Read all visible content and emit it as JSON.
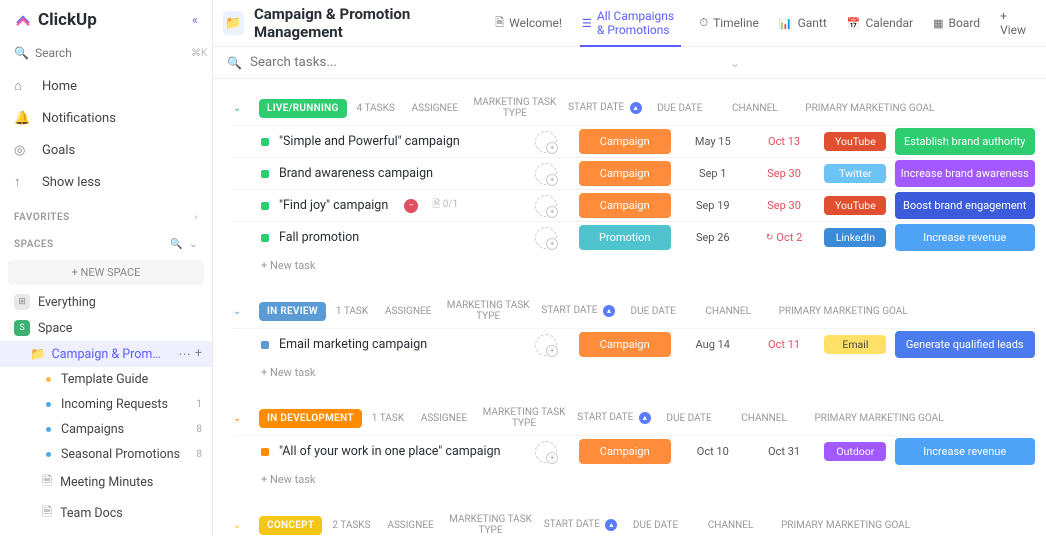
{
  "brand": "ClickUp",
  "sidebar": {
    "search_placeholder": "Search",
    "search_shortcut": "⌘K",
    "nav": [
      {
        "label": "Home"
      },
      {
        "label": "Notifications"
      },
      {
        "label": "Goals"
      },
      {
        "label": "Show less"
      }
    ],
    "favorites_label": "FAVORITES",
    "spaces_label": "SPACES",
    "new_space": "+  NEW SPACE",
    "tree": {
      "everything": "Everything",
      "space": "Space",
      "list": {
        "label": "Campaign & Promotion M...",
        "children": [
          {
            "label": "Template Guide",
            "dot": "#f5b941"
          },
          {
            "label": "Incoming Requests",
            "dot": "#49aae0",
            "count": "1"
          },
          {
            "label": "Campaigns",
            "dot": "#49aae0",
            "count": "8"
          },
          {
            "label": "Seasonal Promotions",
            "dot": "#49aae0",
            "count": "8"
          },
          {
            "label": "Meeting Minutes",
            "doc": true
          },
          {
            "label": "Team Docs",
            "doc": true
          }
        ]
      }
    }
  },
  "breadcrumb": "Campaign & Promotion Management",
  "tabs": [
    {
      "label": "Welcome!"
    },
    {
      "label": "All Campaigns & Promotions",
      "active": true
    },
    {
      "label": "Timeline"
    },
    {
      "label": "Gantt"
    },
    {
      "label": "Calendar"
    },
    {
      "label": "Board"
    },
    {
      "label": "+  View"
    }
  ],
  "taskbar": {
    "search_placeholder": "Search tasks..."
  },
  "columns": {
    "assignee": "ASSIGNEE",
    "mtype": "MARKETING TASK TYPE",
    "start": "START DATE",
    "due": "DUE DATE",
    "channel": "CHANNEL",
    "goal": "PRIMARY MARKETING GOAL"
  },
  "new_task": "+ New task",
  "groups": [
    {
      "status": "LIVE/RUNNING",
      "color": "#2ecd6f",
      "count": "4 TASKS",
      "rows": [
        {
          "dot": "#2ecd6f",
          "title": "\"Simple and Powerful\" campaign",
          "mtype": "Campaign",
          "mtype_c": "#ff8c3b",
          "start": "May 15",
          "due": "Oct 13",
          "channel": "YouTube",
          "channel_c": "#e04f2f",
          "goal": "Establish brand authority",
          "goal_c": "#2ecd6f"
        },
        {
          "dot": "#2ecd6f",
          "title": "Brand awareness campaign",
          "mtype": "Campaign",
          "mtype_c": "#ff8c3b",
          "start": "Sep 1",
          "due": "Sep 30",
          "channel": "Twitter",
          "channel_c": "#6cc4f5",
          "goal": "Increase brand awareness",
          "goal_c": "#a259ff"
        },
        {
          "dot": "#2ecd6f",
          "title": "\"Find joy\" campaign",
          "blocked": true,
          "sub": "0/1",
          "mtype": "Campaign",
          "mtype_c": "#ff8c3b",
          "start": "Sep 19",
          "due": "Sep 30",
          "channel": "YouTube",
          "channel_c": "#e04f2f",
          "goal": "Boost brand engagement",
          "goal_c": "#3b5bdb"
        },
        {
          "dot": "#2ecd6f",
          "title": "Fall promotion",
          "mtype": "Promotion",
          "mtype_c": "#4fc4cf",
          "start": "Sep 26",
          "due": "Oct 2",
          "due_rec": true,
          "channel": "LinkedIn",
          "channel_c": "#3b8bd9",
          "goal": "Increase revenue",
          "goal_c": "#4fa3f7"
        }
      ]
    },
    {
      "status": "IN REVIEW",
      "color": "#5b9bd5",
      "count": "1 TASK",
      "rows": [
        {
          "dot": "#5b9bd5",
          "title": "Email marketing campaign",
          "mtype": "Campaign",
          "mtype_c": "#ff8c3b",
          "start": "Aug 14",
          "due": "Oct 11",
          "channel": "Email",
          "channel_c": "#ffe066",
          "channel_tc": "#444",
          "goal": "Generate qualified leads",
          "goal_c": "#4b7bec"
        }
      ]
    },
    {
      "status": "IN DEVELOPMENT",
      "color": "#ff8c00",
      "count": "1 TASK",
      "rows": [
        {
          "dot": "#ff8c00",
          "title": "\"All of your work in one place\" campaign",
          "mtype": "Campaign",
          "mtype_c": "#ff8c3b",
          "start": "Oct 10",
          "due": "Oct 31",
          "due_c": "#555",
          "channel": "Outdoor",
          "channel_c": "#a259ff",
          "goal": "Increase revenue",
          "goal_c": "#4fa3f7"
        }
      ]
    },
    {
      "status": "CONCEPT",
      "color": "#f5c518",
      "count": "2 TASKS",
      "rows": []
    }
  ]
}
